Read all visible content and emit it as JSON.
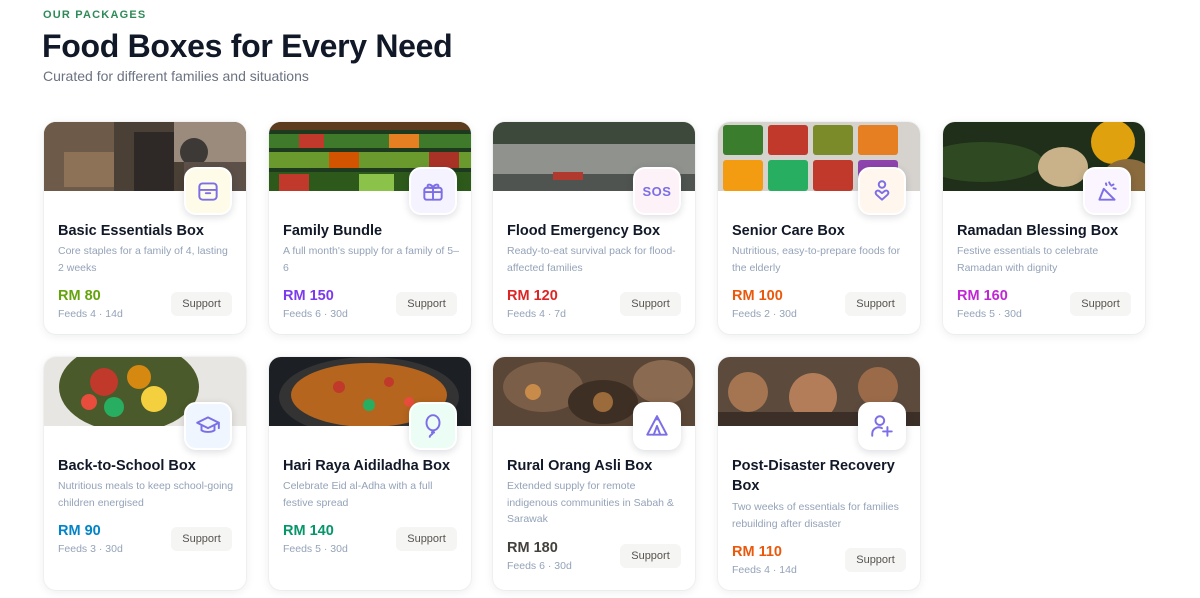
{
  "header": {
    "eyebrow": "OUR PACKAGES",
    "title": "Food Boxes for Every Need",
    "subtitle": "Curated for different families and situations"
  },
  "support_label": "Support",
  "cards": [
    {
      "title": "Basic Essentials Box",
      "desc": "Core staples for a family of 4, lasting 2 weeks",
      "price": "RM 80",
      "meta": "Feeds 4 · 14d",
      "price_color": "#65a30d",
      "icon": "box-icon"
    },
    {
      "title": "Family Bundle",
      "desc": "A full month's supply for a family of 5–6",
      "price": "RM 150",
      "meta": "Feeds 6 · 30d",
      "price_color": "#7c3aed",
      "icon": "gift-icon"
    },
    {
      "title": "Flood Emergency Box",
      "desc": "Ready-to-eat survival pack for flood-affected families",
      "price": "RM 120",
      "meta": "Feeds 4 · 7d",
      "price_color": "#dc2626",
      "icon": "sos-icon",
      "icon_text": "SOS"
    },
    {
      "title": "Senior Care Box",
      "desc": "Nutritious, easy-to-prepare foods for the elderly",
      "price": "RM 100",
      "meta": "Feeds 2 · 30d",
      "price_color": "#ea580c",
      "icon": "person-heart-icon"
    },
    {
      "title": "Ramadan Blessing Box",
      "desc": "Festive essentials to celebrate Ramadan with dignity",
      "price": "RM 160",
      "meta": "Feeds 5 · 30d",
      "price_color": "#c026d3",
      "icon": "party-icon"
    },
    {
      "title": "Back-to-School Box",
      "desc": "Nutritious meals to keep school-going children energised",
      "price": "RM 90",
      "meta": "Feeds 3 · 30d",
      "price_color": "#0284c7",
      "icon": "graduation-cap-icon"
    },
    {
      "title": "Hari Raya Aidiladha Box",
      "desc": "Celebrate Eid al-Adha with a full festive spread",
      "price": "RM 140",
      "meta": "Feeds 5 · 30d",
      "price_color": "#059669",
      "icon": "balloon-icon"
    },
    {
      "title": "Rural Orang Asli Box",
      "desc": "Extended supply for remote indigenous communities in Sabah & Sarawak",
      "price": "RM 180",
      "meta": "Feeds 6 · 30d",
      "price_color": "#44403c",
      "icon": "tent-icon"
    },
    {
      "title": "Post-Disaster Recovery Box",
      "desc": "Two weeks of essentials for families rebuilding after disaster",
      "price": "RM 110",
      "meta": "Feeds 4 · 14d",
      "price_color": "#ea580c",
      "icon": "user-plus-icon"
    }
  ]
}
